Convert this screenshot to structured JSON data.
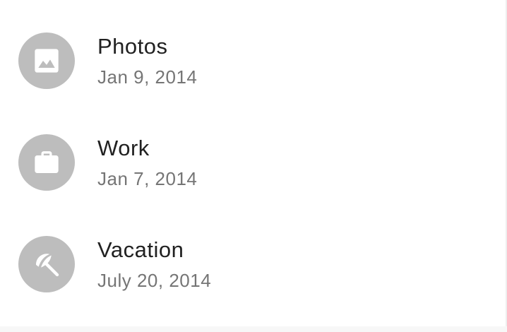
{
  "list": {
    "items": [
      {
        "title": "Photos",
        "date": "Jan 9, 2014",
        "icon": "image-icon"
      },
      {
        "title": "Work",
        "date": "Jan 7, 2014",
        "icon": "briefcase-icon"
      },
      {
        "title": "Vacation",
        "date": "July 20, 2014",
        "icon": "beach-umbrella-icon"
      }
    ]
  },
  "colors": {
    "avatar_bg": "#bdbdbd",
    "primary_text": "#212121",
    "secondary_text": "#757575",
    "background": "#ffffff"
  }
}
